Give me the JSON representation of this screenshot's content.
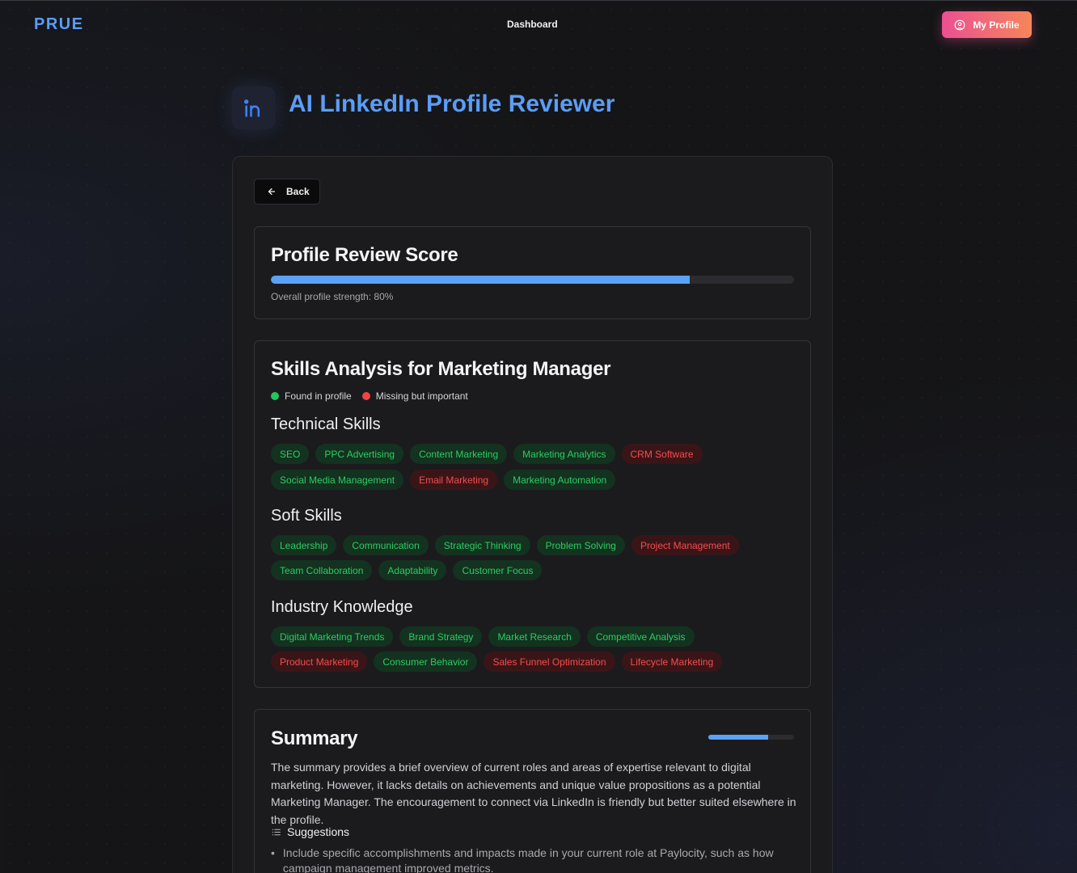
{
  "nav": {
    "logo": "PRUE",
    "dashboard": "Dashboard",
    "profile_button": "My Profile"
  },
  "hero": {
    "icon": "linkedin-icon",
    "title": "AI LinkedIn Profile Reviewer"
  },
  "back_label": "Back",
  "score": {
    "title": "Profile Review Score",
    "caption": "Overall profile strength: 80%",
    "value_percent": 80
  },
  "skills": {
    "title": "Skills Analysis for Marketing Manager",
    "legend": {
      "found": "Found in profile",
      "missing": "Missing but important",
      "found_color": "#22c55e",
      "missing_color": "#ef4444"
    },
    "sections": [
      {
        "title": "Technical Skills",
        "rows": [
          [
            {
              "label": "SEO",
              "status": "found"
            },
            {
              "label": "PPC Advertising",
              "status": "found"
            },
            {
              "label": "Content Marketing",
              "status": "found"
            },
            {
              "label": "Marketing Analytics",
              "status": "found"
            },
            {
              "label": "CRM Software",
              "status": "missing"
            }
          ],
          [
            {
              "label": "Social Media Management",
              "status": "found"
            },
            {
              "label": "Email Marketing",
              "status": "missing"
            },
            {
              "label": "Marketing Automation",
              "status": "found"
            }
          ]
        ]
      },
      {
        "title": "Soft Skills",
        "rows": [
          [
            {
              "label": "Leadership",
              "status": "found"
            },
            {
              "label": "Communication",
              "status": "found"
            },
            {
              "label": "Strategic Thinking",
              "status": "found"
            },
            {
              "label": "Problem Solving",
              "status": "found"
            },
            {
              "label": "Project Management",
              "status": "missing"
            }
          ],
          [
            {
              "label": "Team Collaboration",
              "status": "found"
            },
            {
              "label": "Adaptability",
              "status": "found"
            },
            {
              "label": "Customer Focus",
              "status": "found"
            }
          ]
        ]
      },
      {
        "title": "Industry Knowledge",
        "rows": [
          [
            {
              "label": "Digital Marketing Trends",
              "status": "found"
            },
            {
              "label": "Brand Strategy",
              "status": "found"
            },
            {
              "label": "Market Research",
              "status": "found"
            },
            {
              "label": "Competitive Analysis",
              "status": "found"
            }
          ],
          [
            {
              "label": "Product Marketing",
              "status": "missing"
            },
            {
              "label": "Consumer Behavior",
              "status": "found"
            },
            {
              "label": "Sales Funnel Optimization",
              "status": "missing"
            },
            {
              "label": "Lifecycle Marketing",
              "status": "missing"
            }
          ]
        ]
      }
    ]
  },
  "summary": {
    "title": "Summary",
    "score_fraction": 0.7,
    "text": "The summary provides a brief overview of current roles and areas of expertise relevant to digital marketing. However, it lacks details on achievements and unique value propositions as a potential Marketing Manager. The encouragement to connect via LinkedIn is friendly but better suited elsewhere in the profile.",
    "suggestions_label": "Suggestions",
    "suggestions": [
      "Include specific accomplishments and impacts made in your current role at Paylocity, such as how campaign management improved metrics."
    ]
  },
  "colors": {
    "accent_blue": "#5a9df7",
    "found_text": "#2ecc64",
    "missing_text": "#f44d4d"
  }
}
